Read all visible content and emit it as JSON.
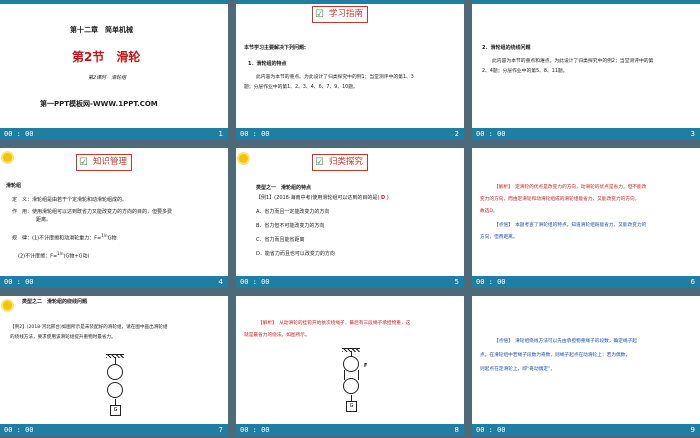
{
  "slides": [
    {
      "chapter": "第十二章　简单机械",
      "section": "第2节　滑轮",
      "lesson": "第2课时　滑轮组",
      "site": "第一PPT模板网-WWW.1PPT.COM",
      "time": "00 : 00",
      "num": "1"
    },
    {
      "title": "学习指南",
      "l1": "本节学习主要解决下列问题:",
      "l2": "1．滑轮组的特点",
      "l3": "此内容为本节的重点。为此设计了归类探究中的例1；当堂测评中的第1、3",
      "l4": "题；分层作业中的第1、2、3、4、6、7、9、10题。",
      "time": "00 : 00",
      "num": "2"
    },
    {
      "l1": "2．滑轮组的绕线问题",
      "l2": "此内容为本节的重点和难点。为此设计了归类探究中的例2；当堂测评中的第",
      "l3": "2、4题；分层作业中的第5、8、11题。",
      "time": "00 : 00",
      "num": "3"
    },
    {
      "title": "知识管理",
      "h": "滑轮组",
      "d1": "定　义：滑轮组是由若干个定滑轮和动滑轮组成的。",
      "d2": "作　用：使用滑轮组可以达到既省力又能改变力的方向的目的，但要多费",
      "d3": "距离。",
      "r1": "规　律：(1)不计摩擦和动滑轮重力：F=",
      "r1b": "G物",
      "r2": "(2)不计摩擦：F=",
      "r2b": "(G物+G动)",
      "frac": "1/n",
      "time": "00 : 00",
      "num": "4"
    },
    {
      "title": "归类探究",
      "type": "类型之一　滑轮组的特点",
      "ex": "【例1】(2018·海南中考)使用滑轮组可以达到的目的是(",
      "ans": "D",
      ")": ")",
      "a": "A．省力而且一定能改变力的方向",
      "b": "B．省力但不可能改变力的方向",
      "c": "C．省力而且能省距离",
      "d": "D．能省力而且也可以改变力的方向",
      "time": "00 : 00",
      "num": "5"
    },
    {
      "l1": "【解析】　定滑轮的优点是改变力的方向，动滑轮的优点是省力，但不能改",
      "l2": "变力的方向，而由定滑轮和动滑轮组成的滑轮组能省力，又能改变力的方向，",
      "l3": "故选D。",
      "l4": "【点悟】　本题考查了滑轮组的特点，知道滑轮组既能省力，又能改变力的",
      "l5": "方向，但费距离。",
      "time": "00 : 00",
      "num": "6"
    },
    {
      "type": "类型之二　滑轮组的绕线问题",
      "ex": "【例2】(2018·河北邢台)如图所示是未装配好的滑轮组，请在图中画出滑轮组",
      "ex2": "的绕线方法，要求使用该滑轮组提升重物时最省力。",
      "g": "G",
      "time": "00 : 00",
      "num": "7"
    },
    {
      "l1": "【解析】　从动滑轮的挂钩开始依次绕绳子，最后有三段绳子承担物重，这",
      "l2": "就是最省力的绕法。如图所示。",
      "f": "F",
      "g": "G",
      "time": "00 : 00",
      "num": "8"
    },
    {
      "l1": "【点悟】　滑轮组绕线方法可以先由承担物重绳子的段数，确定绳子起",
      "l2": "点。在滑轮组中若绳子段数为奇数，则绳子起点在动滑轮上；若为偶数，",
      "l3": "则起点在定滑轮上，即“奇动偶定”。",
      "time": "00 : 00",
      "num": "9"
    }
  ]
}
